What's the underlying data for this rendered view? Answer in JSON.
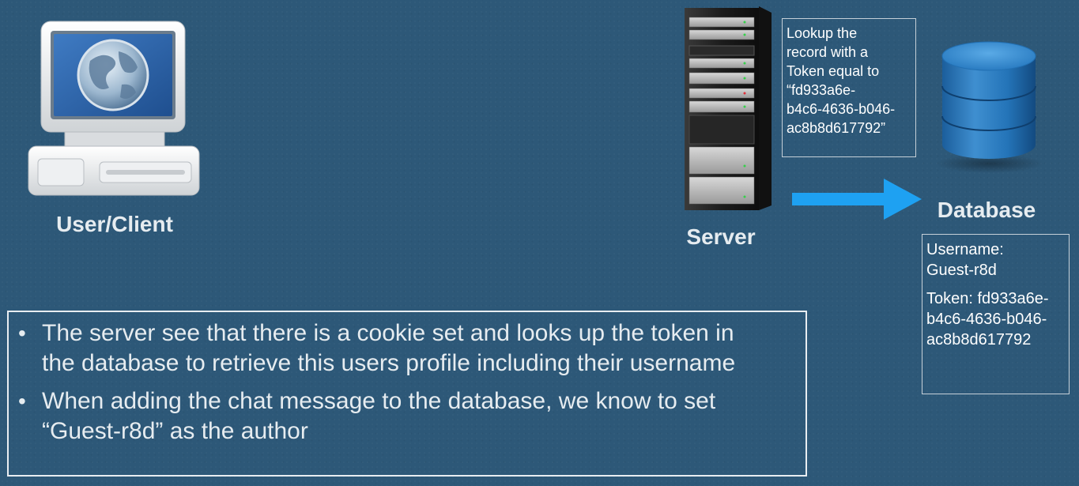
{
  "client": {
    "label": "User/Client",
    "icon": "computer-globe-icon"
  },
  "server": {
    "label": "Server",
    "icon": "server-rack-icon",
    "lookup_lines": [
      "Lookup the",
      "record with a",
      "Token equal to",
      "“fd933a6e-",
      "b4c6-4636-b046-",
      "ac8b8d617792”"
    ]
  },
  "arrow": {
    "icon": "right-arrow-icon",
    "color": "#1ea1f2"
  },
  "database": {
    "label": "Database",
    "icon": "database-cylinder-icon",
    "record": {
      "username_lines": [
        "Username:",
        "Guest-r8d"
      ],
      "token_lines": [
        "Token: fd933a6e-",
        "b4c6-4636-b046-",
        "ac8b8d617792"
      ]
    }
  },
  "bullets": {
    "items": [
      {
        "lines": [
          "The server see that there is a cookie set and looks up the token in",
          "the database to retrieve this users profile including their username"
        ]
      },
      {
        "lines": [
          "When adding the chat message to the database, we know to set",
          "“Guest-r8d” as the author"
        ]
      }
    ]
  },
  "colors": {
    "background": "#2d5878",
    "text": "#ffffff",
    "accent_arrow": "#1ea1f2",
    "database_blue": "#1d6db0"
  }
}
